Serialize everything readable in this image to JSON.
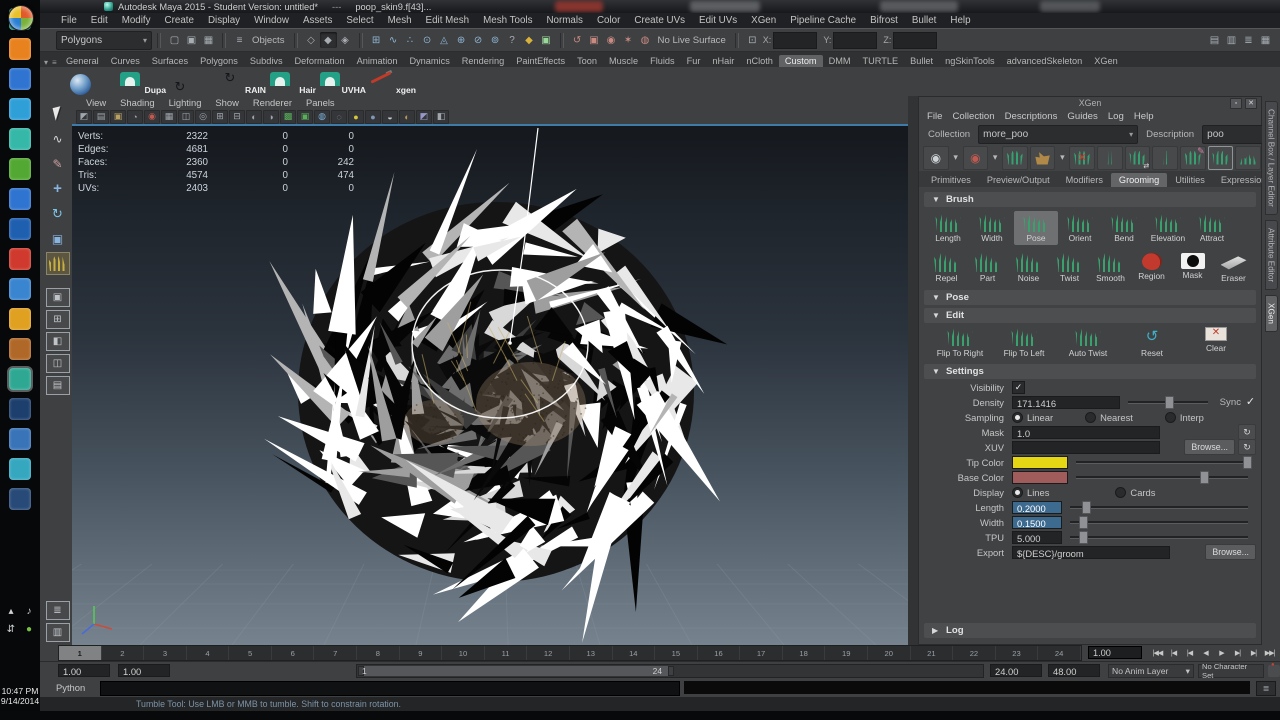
{
  "os": {
    "clock_time": "10:47 PM",
    "clock_date": "9/14/2014",
    "taskbar_icons": [
      {
        "n": "taskbar-app-icon",
        "c": "#35b8a8"
      },
      {
        "n": "taskbar-app-icon",
        "c": "#e8821e"
      },
      {
        "n": "taskbar-app-icon",
        "c": "#2f74d0"
      },
      {
        "n": "taskbar-app-icon",
        "c": "#2f9fd8"
      },
      {
        "n": "taskbar-app-icon",
        "c": "#35b8a8"
      },
      {
        "n": "taskbar-app-icon",
        "c": "#52a832"
      },
      {
        "n": "taskbar-app-icon",
        "c": "#2f74d0"
      },
      {
        "n": "taskbar-app-icon",
        "c": "#1f5fb0"
      },
      {
        "n": "taskbar-app-icon",
        "c": "#d03a2e"
      },
      {
        "n": "taskbar-app-icon",
        "c": "#3a85d0"
      },
      {
        "n": "taskbar-app-icon",
        "c": "#e0a020"
      },
      {
        "n": "taskbar-app-icon",
        "c": "#b06828"
      },
      {
        "n": "taskbar-maya-icon",
        "c": "#2fa893",
        "active": true
      },
      {
        "n": "taskbar-app-icon",
        "c": "#1d3f6e"
      },
      {
        "n": "taskbar-app-icon",
        "c": "#3a74b8"
      },
      {
        "n": "taskbar-app-icon",
        "c": "#35a8c0"
      },
      {
        "n": "taskbar-app-icon",
        "c": "#284a78"
      }
    ],
    "tray_icons": [
      {
        "n": "show-hidden-icons-button",
        "g": "▴"
      },
      {
        "n": "volume-icon",
        "g": "♪"
      },
      {
        "n": "network-icon",
        "g": "⇵"
      },
      {
        "n": "greenshot-icon",
        "g": "●",
        "gc": "#7ac143"
      }
    ]
  },
  "titlebar": {
    "title": "Autodesk Maya 2015 - Student Version: untitled*",
    "separator": "---",
    "document": "poop_skin9.f[43]..."
  },
  "menubar": {
    "items": [
      "File",
      "Edit",
      "Modify",
      "Create",
      "Display",
      "Window",
      "Assets",
      "Select",
      "Mesh",
      "Edit Mesh",
      "Mesh Tools",
      "Normals",
      "Color",
      "Create UVs",
      "Edit UVs",
      "XGen",
      "Pipeline Cache",
      "Bifrost",
      "Bullet",
      "Help"
    ]
  },
  "statusline": {
    "mode": "Polygons",
    "objects_label": "Objects",
    "objects_icon": "≡",
    "no_live_surface": "No Live Surface",
    "x_label": "X:",
    "y_label": "Y:",
    "z_label": "Z:",
    "file_icons": [
      {
        "n": "new-scene-icon",
        "g": "▢"
      },
      {
        "n": "open-scene-icon",
        "g": "▣"
      },
      {
        "n": "save-scene-icon",
        "g": "▦"
      }
    ],
    "select_icons": [
      {
        "n": "select-by-hierarchy-icon",
        "g": "◇"
      },
      {
        "n": "select-by-object-icon",
        "g": "◆",
        "dark": true
      },
      {
        "n": "select-by-component-icon",
        "g": "◈"
      }
    ],
    "snap_icons": [
      {
        "n": "snap-to-grid-icon",
        "g": "⊞",
        "c": "#8fb4d4"
      },
      {
        "n": "snap-to-curve-icon",
        "g": "∿",
        "c": "#8fb4d4"
      },
      {
        "n": "snap-to-point-icon",
        "g": "∴",
        "c": "#8fb4d4"
      },
      {
        "n": "snap-to-projected-center-icon",
        "g": "⊙",
        "c": "#8fb4d4"
      },
      {
        "n": "make-live-icon",
        "g": "◬",
        "c": "#8fb4d4"
      },
      {
        "n": "snap-together-icon",
        "g": "⊕",
        "c": "#8fb4d4"
      },
      {
        "n": "snap-view-icon",
        "g": "⊘",
        "c": "#8fb4d4"
      },
      {
        "n": "snap-rotate-icon",
        "g": "⊚",
        "c": "#8fb4d4"
      }
    ],
    "help_icon": "?",
    "lock_icons": [
      {
        "n": "lock-selection-icon",
        "g": "◆",
        "c": "#d8b23a"
      },
      {
        "n": "highlight-selection-icon",
        "g": "▣",
        "c": "#9ad89a"
      }
    ],
    "history_icons": [
      {
        "n": "construction-history-icon",
        "g": "↺",
        "c": "#c88a82"
      },
      {
        "n": "render-view-icon",
        "g": "▣",
        "c": "#c88a82"
      },
      {
        "n": "ipr-render-icon",
        "g": "◉",
        "c": "#c88a82"
      },
      {
        "n": "render-settings-icon",
        "g": "✶",
        "c": "#c88a82"
      },
      {
        "n": "hypershade-icon",
        "g": "◍",
        "c": "#c88a82"
      }
    ],
    "input_icons": [
      {
        "n": "absolute-relative-toggle-icon",
        "g": "⊡"
      }
    ],
    "right_icons": [
      {
        "n": "sidebar-toggle-icon",
        "g": "▤"
      },
      {
        "n": "attribute-editor-toggle-icon",
        "g": "▥"
      },
      {
        "n": "tool-settings-toggle-icon",
        "g": "≣"
      },
      {
        "n": "channel-box-toggle-icon",
        "g": "▦"
      }
    ]
  },
  "shelf": {
    "tabs": [
      {
        "label": "General"
      },
      {
        "label": "Curves"
      },
      {
        "label": "Surfaces"
      },
      {
        "label": "Polygons"
      },
      {
        "label": "Subdivs"
      },
      {
        "label": "Deformation"
      },
      {
        "label": "Animation"
      },
      {
        "label": "Dynamics"
      },
      {
        "label": "Rendering"
      },
      {
        "label": "PaintEffects"
      },
      {
        "label": "Toon"
      },
      {
        "label": "Muscle"
      },
      {
        "label": "Fluids"
      },
      {
        "label": "Fur"
      },
      {
        "label": "nHair"
      },
      {
        "label": "nCloth"
      },
      {
        "label": "Custom",
        "active": true
      },
      {
        "label": "DMM"
      },
      {
        "label": "TURTLE"
      },
      {
        "label": "Bullet"
      },
      {
        "label": "ngSkinTools"
      },
      {
        "label": "advancedSkeleton"
      },
      {
        "label": "XGen"
      }
    ],
    "items": [
      {
        "n": "maya-logo-shelf-button",
        "icon": "sphere",
        "label": ""
      },
      {
        "n": "dupa-shelf-button",
        "icon": "arch",
        "label": "Dupa"
      },
      {
        "n": "loop-shelf-button",
        "icon": "loop",
        "label": ""
      },
      {
        "n": "rain-shelf-button",
        "icon": "loop",
        "label": "RAIN"
      },
      {
        "n": "hair-shelf-button",
        "icon": "arch",
        "label": "Hair"
      },
      {
        "n": "uvha-shelf-button",
        "icon": "arch",
        "label": "UVHA"
      },
      {
        "n": "xgen-shelf-button",
        "icon": "brushx",
        "label": "xgen"
      }
    ]
  },
  "toolbox": {
    "tools": [
      {
        "n": "select-tool",
        "icon": "cursor"
      },
      {
        "n": "lasso-select-tool",
        "icon": "lasso"
      },
      {
        "n": "paint-select-tool",
        "icon": "brush"
      },
      {
        "n": "move-tool",
        "icon": "move"
      },
      {
        "n": "rotate-tool",
        "icon": "rotate"
      },
      {
        "n": "scale-tool",
        "icon": "scale"
      },
      {
        "n": "xgen-grooming-tool",
        "icon": "grass",
        "active": true
      }
    ],
    "layouts": [
      {
        "n": "single-pane-layout-button",
        "g": "▣"
      },
      {
        "n": "four-pane-layout-button",
        "g": "⊞"
      },
      {
        "n": "persp-outliner-layout-button",
        "g": "◧"
      },
      {
        "n": "persp-graph-layout-button",
        "g": "◫"
      },
      {
        "n": "hypershade-layout-button",
        "g": "▤"
      }
    ],
    "bottom": [
      {
        "n": "outliner-layout-button",
        "g": "≣"
      },
      {
        "n": "spare-layout-button",
        "g": "▥"
      }
    ]
  },
  "viewport": {
    "menus": [
      "View",
      "Shading",
      "Lighting",
      "Show",
      "Renderer",
      "Panels"
    ],
    "icons": [
      {
        "n": "select-camera-icon",
        "g": "◩",
        "c": "#9fa6ac"
      },
      {
        "n": "lock-camera-icon",
        "g": "▤",
        "c": "#9fa6ac"
      },
      {
        "n": "camera-attributes-icon",
        "g": "▣",
        "c": "#b8a060"
      },
      {
        "n": "bookmark-icon",
        "g": "◔",
        "c": "#9fa6ac"
      },
      {
        "n": "image-plane-icon",
        "g": "◉",
        "c": "#c05a50"
      },
      {
        "n": "view-compass-icon",
        "g": "▦",
        "c": "#9fa6ac"
      },
      {
        "n": "2d-pan-zoom-icon",
        "g": "◫",
        "c": "#9fa6ac"
      },
      {
        "n": "oo-box-icon",
        "g": "◎",
        "c": "#9fa6ac"
      },
      {
        "n": "grid-toggle-icon",
        "g": "⊞",
        "c": "#9fa6ac"
      },
      {
        "n": "film-gate-icon",
        "g": "⊟",
        "c": "#9fa6ac"
      },
      {
        "n": "gate-mask-icon",
        "g": "◐",
        "c": "#9fa6ac"
      },
      {
        "n": "field-chart-icon",
        "g": "◑",
        "c": "#9fa6ac"
      },
      {
        "n": "safe-action-icon",
        "g": "▩",
        "c": "#58b058"
      },
      {
        "n": "wireframe-on-shaded-icon",
        "g": "▣",
        "c": "#58b058"
      },
      {
        "n": "textured-icon",
        "g": "◍",
        "c": "#7ab0d8"
      },
      {
        "n": "use-default-material-icon",
        "g": "◌",
        "c": "#9fa6ac"
      },
      {
        "n": "lighting-icon",
        "g": "●",
        "c": "#d8c838"
      },
      {
        "n": "shadows-icon",
        "g": "●",
        "c": "#8098b8"
      },
      {
        "n": "screen-space-ao-icon",
        "g": "◒",
        "c": "#c8c8c8"
      },
      {
        "n": "motion-blur-icon",
        "g": "◐",
        "c": "#b89858"
      },
      {
        "n": "multisample-icon",
        "g": "◩",
        "c": "#9898c8"
      },
      {
        "n": "isolate-select-icon",
        "g": "◧",
        "c": "#9fa6ac"
      }
    ],
    "hud_rows": [
      {
        "label": "Verts:",
        "v1": "2322",
        "v2": "0",
        "v3": "0"
      },
      {
        "label": "Edges:",
        "v1": "4681",
        "v2": "0",
        "v3": "0"
      },
      {
        "label": "Faces:",
        "v1": "2360",
        "v2": "0",
        "v3": "242"
      },
      {
        "label": "Tris:",
        "v1": "4574",
        "v2": "0",
        "v3": "474"
      },
      {
        "label": "UVs:",
        "v1": "2403",
        "v2": "0",
        "v3": "0"
      }
    ]
  },
  "xgen": {
    "title": "XGen",
    "window_buttons": {
      "undock": "▫",
      "close": "✕"
    },
    "menus": [
      "File",
      "Collection",
      "Descriptions",
      "Guides",
      "Log",
      "Help"
    ],
    "collection_label": "Collection",
    "collection_value": "more_poo",
    "description_label": "Description",
    "description_value": "poo",
    "toolbar": [
      {
        "n": "preview-toggle-icon",
        "kind": "eye"
      },
      {
        "n": "preview-menu-caret",
        "kind": "caret"
      },
      {
        "n": "clear-preview-icon",
        "kind": "eye-red"
      },
      {
        "n": "clear-preview-caret",
        "kind": "caret"
      },
      {
        "n": "update-preview-icon",
        "kind": "grass"
      },
      {
        "n": "export-patches-icon",
        "kind": "pouch"
      },
      {
        "n": "export-caret",
        "kind": "caret"
      },
      {
        "n": "delete-guides-icon",
        "kind": "xguide"
      },
      {
        "n": "add-guide-icon",
        "kind": "guide"
      },
      {
        "n": "move-guide-icon",
        "kind": "guide-move"
      },
      {
        "n": "duplicate-guide-icon",
        "kind": "guide"
      },
      {
        "n": "comb-guides-icon",
        "kind": "comb"
      },
      {
        "n": "convert-to-guides-icon",
        "kind": "framed"
      },
      {
        "n": "ground-guides-icon",
        "kind": "mound"
      }
    ],
    "tabs": [
      {
        "label": "Primitives"
      },
      {
        "label": "Preview/Output"
      },
      {
        "label": "Modifiers"
      },
      {
        "label": "Grooming",
        "active": true
      },
      {
        "label": "Utilities"
      },
      {
        "label": "Expressions"
      }
    ],
    "brush_header": "Brush",
    "brush_tools_row1": [
      {
        "label": "Length"
      },
      {
        "label": "Width"
      },
      {
        "label": "Pose",
        "active": true
      },
      {
        "label": "Orient"
      },
      {
        "label": "Bend"
      },
      {
        "label": "Elevation"
      },
      {
        "label": "Attract"
      }
    ],
    "brush_tools_row2": [
      {
        "label": "Repel"
      },
      {
        "label": "Part"
      },
      {
        "label": "Noise"
      },
      {
        "label": "Twist"
      },
      {
        "label": "Smooth"
      },
      {
        "label": "Region",
        "icon": "region"
      },
      {
        "label": "Mask",
        "icon": "mask"
      },
      {
        "label": "Eraser",
        "icon": "eraser"
      }
    ],
    "pose_header": "Pose",
    "edit_header": "Edit",
    "edit_actions": [
      {
        "label": "Flip To Right",
        "icon": "flip"
      },
      {
        "label": "Flip To Left",
        "icon": "flip"
      },
      {
        "label": "Auto Twist",
        "icon": "twist"
      },
      {
        "label": "Reset",
        "icon": "reset"
      },
      {
        "label": "Clear",
        "icon": "clear"
      }
    ],
    "settings_header": "Settings",
    "settings": {
      "visibility_label": "Visibility",
      "visibility_check": "✓",
      "density_label": "Density",
      "density_value": "171.1416",
      "sync_label": "Sync",
      "sync_check": "✓",
      "sampling_label": "Sampling",
      "sampling_options": [
        {
          "label": "Linear",
          "active": true
        },
        {
          "label": "Nearest"
        },
        {
          "label": "Interp"
        }
      ],
      "mask_label": "Mask",
      "mask_value": "1.0",
      "xuv_label": "XUV",
      "xuv_value": "",
      "browse_label": "Browse...",
      "tip_color_label": "Tip Color",
      "tip_color": "#e6d714",
      "base_color_label": "Base Color",
      "base_color": "#a05b5b",
      "display_label": "Display",
      "display_options": [
        {
          "label": "Lines",
          "active": true
        },
        {
          "label": "Cards"
        }
      ],
      "length_label": "Length",
      "length_value": "0.2000",
      "width_label": "Width",
      "width_value": "0.1500",
      "tpu_label": "TPU",
      "tpu_value": "5.000",
      "export_label": "Export",
      "export_value": "${DESC}/groom",
      "export_browse_label": "Browse..."
    },
    "log_header": "Log"
  },
  "side_tabs": [
    {
      "label": "Channel Box / Layer Editor"
    },
    {
      "label": "Attribute Editor"
    },
    {
      "label": "XGen",
      "active": true
    }
  ],
  "timeline": {
    "frames": [
      {
        "n": "1",
        "active": true
      },
      {
        "n": "2"
      },
      {
        "n": "3"
      },
      {
        "n": "4"
      },
      {
        "n": "5"
      },
      {
        "n": "6"
      },
      {
        "n": "7"
      },
      {
        "n": "8"
      },
      {
        "n": "9"
      },
      {
        "n": "10"
      },
      {
        "n": "11"
      },
      {
        "n": "12"
      },
      {
        "n": "13"
      },
      {
        "n": "14"
      },
      {
        "n": "15"
      },
      {
        "n": "16"
      },
      {
        "n": "17"
      },
      {
        "n": "18"
      },
      {
        "n": "19"
      },
      {
        "n": "20"
      },
      {
        "n": "21"
      },
      {
        "n": "22"
      },
      {
        "n": "23"
      },
      {
        "n": "24"
      }
    ],
    "current_time": "1.00",
    "playback": [
      {
        "n": "go-to-start-button",
        "g": "|◀◀"
      },
      {
        "n": "step-back-frame-button",
        "g": "|◀"
      },
      {
        "n": "step-back-key-button",
        "g": "|◀"
      },
      {
        "n": "play-backwards-button",
        "g": "◀"
      },
      {
        "n": "play-forwards-button",
        "g": "▶"
      },
      {
        "n": "step-forward-key-button",
        "g": "▶|"
      },
      {
        "n": "step-forward-frame-button",
        "g": "▶|"
      },
      {
        "n": "go-to-end-button",
        "g": "▶▶|"
      }
    ]
  },
  "range": {
    "anim_start": "1.00",
    "play_start": "1.00",
    "bar_start": "1",
    "bar_end": "24",
    "play_end": "24.00",
    "anim_end": "48.00",
    "anim_layer": "No Anim Layer",
    "character_set": "No Character Set"
  },
  "command_line": {
    "label": "Python"
  },
  "help_line": {
    "message": "Tumble Tool: Use LMB or MMB to tumble. Shift to constrain rotation."
  }
}
